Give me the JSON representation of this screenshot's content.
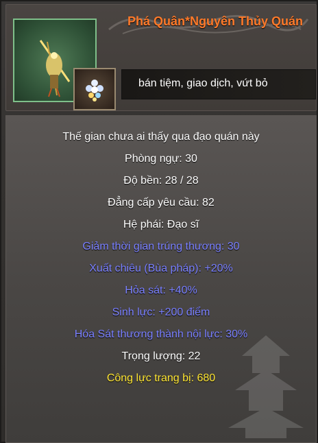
{
  "item": {
    "name": "Phá Quân*Nguyên Thủy Quán",
    "trade_options": "bán tiệm, giao dịch, vứt bỏ",
    "portrait_icon": "sword-figure-icon",
    "gem_icon": "gem-cluster-icon"
  },
  "stats": {
    "flavor": "Thế gian chưa ai thấy qua đạo quán này",
    "defense": "Phòng ngự: 30",
    "durability": "Độ bền:  28 /  28",
    "level_req": "Đẳng cấp yêu cầu: 82",
    "faction": "Hệ phái: Đạo sĩ",
    "bonus1": "Giảm thời gian trúng thương: 30",
    "bonus2": "Xuất chiêu (Bùa pháp): +20%",
    "bonus3": "Hỏa sát: +40%",
    "bonus4": "Sinh lực: +200 điểm",
    "bonus5": "Hóa Sát thương thành nội lực: 30%",
    "weight": "Trọng lượng: 22",
    "power": "Công lực trang bị: 680"
  },
  "colors": {
    "title": "#ff7a2a",
    "base_stat": "#ffffff",
    "bonus_stat": "#7a80ff",
    "power_stat": "#ffe634"
  }
}
